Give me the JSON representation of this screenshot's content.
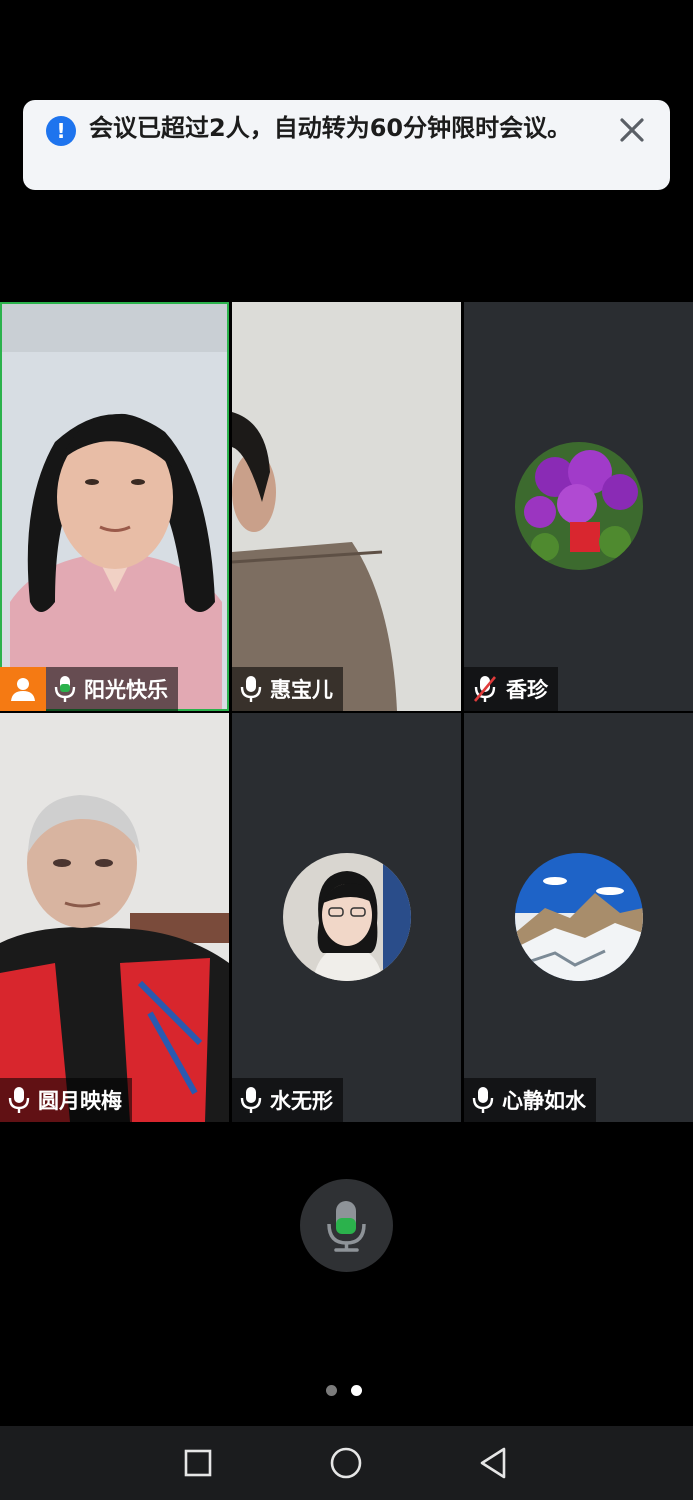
{
  "notice": {
    "message": "会议已超过2人，自动转为60分钟限时会议。",
    "info_glyph": "!"
  },
  "participants": [
    {
      "name": "阳光快乐",
      "mic": "on",
      "host": true,
      "speaking": true,
      "view": "video"
    },
    {
      "name": "惠宝儿",
      "mic": "on",
      "host": false,
      "speaking": false,
      "view": "video"
    },
    {
      "name": "香珍",
      "mic": "muted",
      "host": false,
      "speaking": false,
      "view": "avatar",
      "avatar": "flowers-photo"
    },
    {
      "name": "圆月映梅",
      "mic": "on",
      "host": false,
      "speaking": false,
      "view": "video"
    },
    {
      "name": "水无形",
      "mic": "on",
      "host": false,
      "speaking": false,
      "view": "avatar",
      "avatar": "woman-portrait-photo"
    },
    {
      "name": "心静如水",
      "mic": "on",
      "host": false,
      "speaking": false,
      "view": "avatar",
      "avatar": "snow-mountain-photo"
    }
  ],
  "pager": {
    "pages": 2,
    "current": 2
  },
  "colors": {
    "accent_green": "#2bb24c",
    "host_orange": "#f57a13",
    "info_blue": "#1e74ee"
  }
}
